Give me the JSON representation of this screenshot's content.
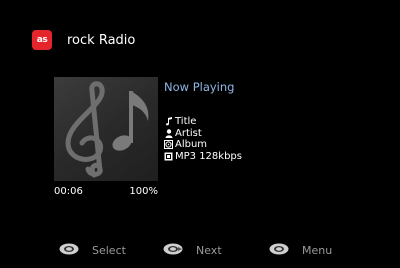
{
  "header": {
    "logo_text": "as",
    "station": "rock Radio"
  },
  "player": {
    "status": "Now Playing",
    "title": "Title",
    "artist": "Artist",
    "album": "Album",
    "format": "MP3 128kbps",
    "elapsed": "00:06",
    "progress_text": "100%",
    "artwork_icon": "music-notes-icon"
  },
  "footer": {
    "select_label": "Select",
    "next_label": "Next",
    "menu_label": "Menu"
  },
  "colors": {
    "background": "#000000",
    "accent": "#8fb6e6",
    "logo": "#e4252b",
    "footer_text": "#9a9a9a"
  }
}
